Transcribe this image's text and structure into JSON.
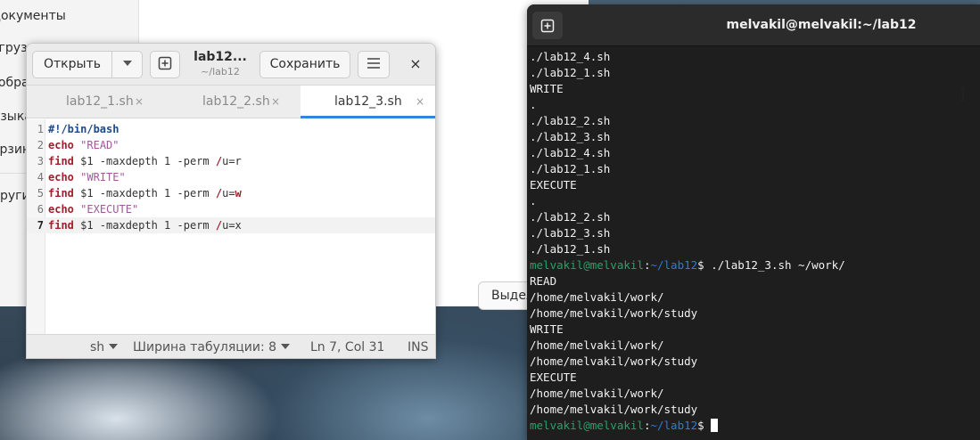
{
  "file_manager": {
    "sidebar": [
      "Документы",
      "Загрузки",
      "Изображения",
      "Музыка",
      "Корзина",
      "Другие"
    ],
    "select_button": "Выделить"
  },
  "editor": {
    "buttons": {
      "open": "Открыть",
      "save": "Сохранить"
    },
    "title": "lab12...",
    "subtitle": "~/lab12",
    "close_glyph": "×",
    "tabs": [
      {
        "label": "lab12_1.sh",
        "close": "×",
        "active": false
      },
      {
        "label": "lab12_2.sh",
        "close": "×",
        "active": false
      },
      {
        "label": "lab12_3.sh",
        "close": "×",
        "active": true
      }
    ],
    "lines": [
      {
        "n": "1",
        "tokens": [
          {
            "t": "#!/bin/bash",
            "c": "kwb"
          }
        ]
      },
      {
        "n": "2",
        "tokens": [
          {
            "t": "echo",
            "c": "kw"
          },
          {
            "t": " "
          },
          {
            "t": "\"READ\"",
            "c": "str"
          }
        ]
      },
      {
        "n": "3",
        "tokens": [
          {
            "t": "find",
            "c": "kw"
          },
          {
            "t": " $1 -maxdepth 1 -perm "
          },
          {
            "t": "/",
            "c": "slash"
          },
          {
            "t": "u=r"
          }
        ]
      },
      {
        "n": "4",
        "tokens": [
          {
            "t": "echo",
            "c": "kw"
          },
          {
            "t": " "
          },
          {
            "t": "\"WRITE\"",
            "c": "str"
          }
        ]
      },
      {
        "n": "5",
        "tokens": [
          {
            "t": "find",
            "c": "kw"
          },
          {
            "t": " $1 -maxdepth 1 -perm "
          },
          {
            "t": "/",
            "c": "slash"
          },
          {
            "t": "u="
          },
          {
            "t": "w",
            "c": "kw"
          }
        ]
      },
      {
        "n": "6",
        "tokens": [
          {
            "t": "echo",
            "c": "kw"
          },
          {
            "t": " "
          },
          {
            "t": "\"EXECUTE\"",
            "c": "str"
          }
        ]
      },
      {
        "n": "7",
        "current": true,
        "tokens": [
          {
            "t": "find",
            "c": "kw"
          },
          {
            "t": " $1 -maxdepth 1 -perm "
          },
          {
            "t": "/",
            "c": "slash"
          },
          {
            "t": "u=x"
          }
        ]
      }
    ],
    "status": {
      "language": "sh",
      "tab_width": "Ширина табуляции: 8",
      "position": "Ln 7, Col 31",
      "mode": "INS"
    }
  },
  "terminal": {
    "title": "melvakil@melvakil:~/lab12",
    "lines": [
      {
        "text": "./lab12_4.sh"
      },
      {
        "text": "./lab12_1.sh"
      },
      {
        "text": "WRITE"
      },
      {
        "text": "."
      },
      {
        "text": "./lab12_2.sh"
      },
      {
        "text": "./lab12_3.sh"
      },
      {
        "text": "./lab12_4.sh"
      },
      {
        "text": "./lab12_1.sh"
      },
      {
        "text": "EXECUTE"
      },
      {
        "text": "."
      },
      {
        "text": "./lab12_2.sh"
      },
      {
        "text": "./lab12_3.sh"
      },
      {
        "text": "./lab12_1.sh"
      },
      {
        "prompt": true,
        "user": "melvakil@melvakil",
        "sep": ":",
        "path": "~/lab12",
        "cmd": "$ ./lab12_3.sh ~/work/"
      },
      {
        "text": "READ"
      },
      {
        "text": "/home/melvakil/work/"
      },
      {
        "text": "/home/melvakil/work/study"
      },
      {
        "text": "WRITE"
      },
      {
        "text": "/home/melvakil/work/"
      },
      {
        "text": "/home/melvakil/work/study"
      },
      {
        "text": "EXECUTE"
      },
      {
        "text": "/home/melvakil/work/"
      },
      {
        "text": "/home/melvakil/work/study"
      },
      {
        "prompt": true,
        "user": "melvakil@melvakil",
        "sep": ":",
        "path": "~/lab12",
        "cmd": "$",
        "cursor": true
      }
    ]
  },
  "icons": {
    "new_tab": "new-tab-icon",
    "menu": "hamburger-menu-icon",
    "dropdown": "chevron-down-icon",
    "close": "close-icon",
    "mouse": "text-cursor-icon"
  }
}
